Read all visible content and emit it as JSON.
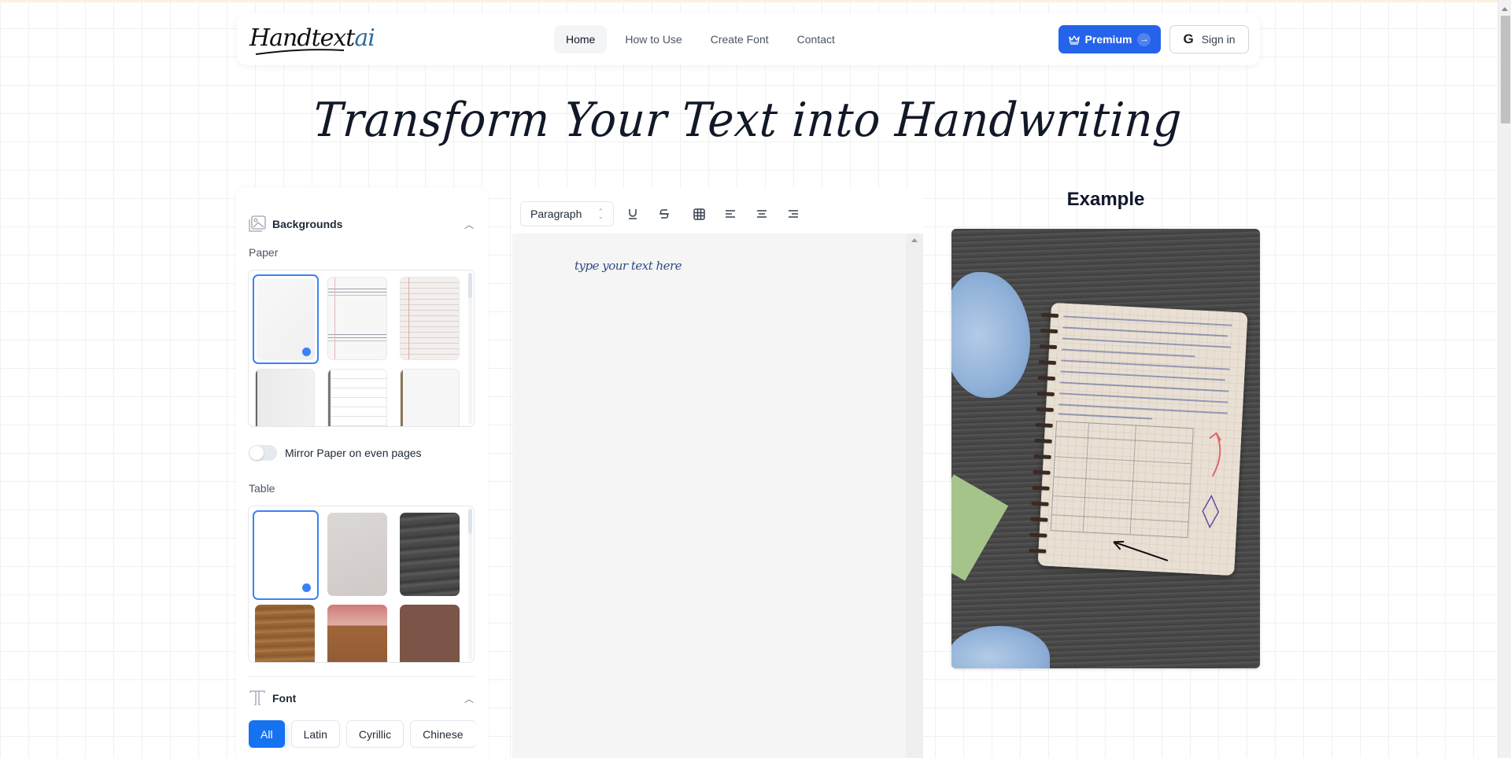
{
  "header": {
    "logo": {
      "main": "Handtext",
      "accent": "ai"
    },
    "nav": [
      {
        "label": "Home",
        "active": true
      },
      {
        "label": "How to Use",
        "active": false
      },
      {
        "label": "Create Font",
        "active": false
      },
      {
        "label": "Contact",
        "active": false
      }
    ],
    "premium_label": "Premium",
    "signin_label": "Sign in",
    "accent_color": "#2563eb"
  },
  "hero": {
    "title": "Transform Your Text into Handwriting"
  },
  "sidebar": {
    "backgrounds": {
      "title": "Backgrounds",
      "paper_label": "Paper",
      "paper_options": [
        {
          "name": "blank",
          "selected": true,
          "locked": false
        },
        {
          "name": "ruled-double",
          "selected": false,
          "locked": false
        },
        {
          "name": "ruled-margin",
          "selected": false,
          "locked": false
        },
        {
          "name": "spiral-blank",
          "selected": false,
          "locked": true
        },
        {
          "name": "spiral-ruled",
          "selected": false,
          "locked": true
        },
        {
          "name": "spiral-lines",
          "selected": false,
          "locked": true
        }
      ],
      "mirror_label": "Mirror Paper on even pages",
      "mirror_enabled": false,
      "table_label": "Table",
      "table_options": [
        {
          "name": "white",
          "selected": true,
          "locked": false
        },
        {
          "name": "grey-surface",
          "selected": false,
          "locked": false
        },
        {
          "name": "dark-wood",
          "selected": false,
          "locked": false
        },
        {
          "name": "wood-plant",
          "selected": false,
          "locked": true
        },
        {
          "name": "wood-calculator",
          "selected": false,
          "locked": true
        },
        {
          "name": "brown-coffee",
          "selected": false,
          "locked": true
        }
      ]
    },
    "font": {
      "title": "Font",
      "filters": [
        {
          "label": "All",
          "active": true
        },
        {
          "label": "Latin",
          "active": false
        },
        {
          "label": "Cyrillic",
          "active": false
        },
        {
          "label": "Chinese",
          "active": false
        }
      ]
    }
  },
  "editor": {
    "block_type": "Paragraph",
    "tools": [
      "underline",
      "strikethrough",
      "table",
      "align-left",
      "align-center",
      "align-right"
    ],
    "placeholder": "type your text here"
  },
  "example": {
    "title": "Example"
  }
}
